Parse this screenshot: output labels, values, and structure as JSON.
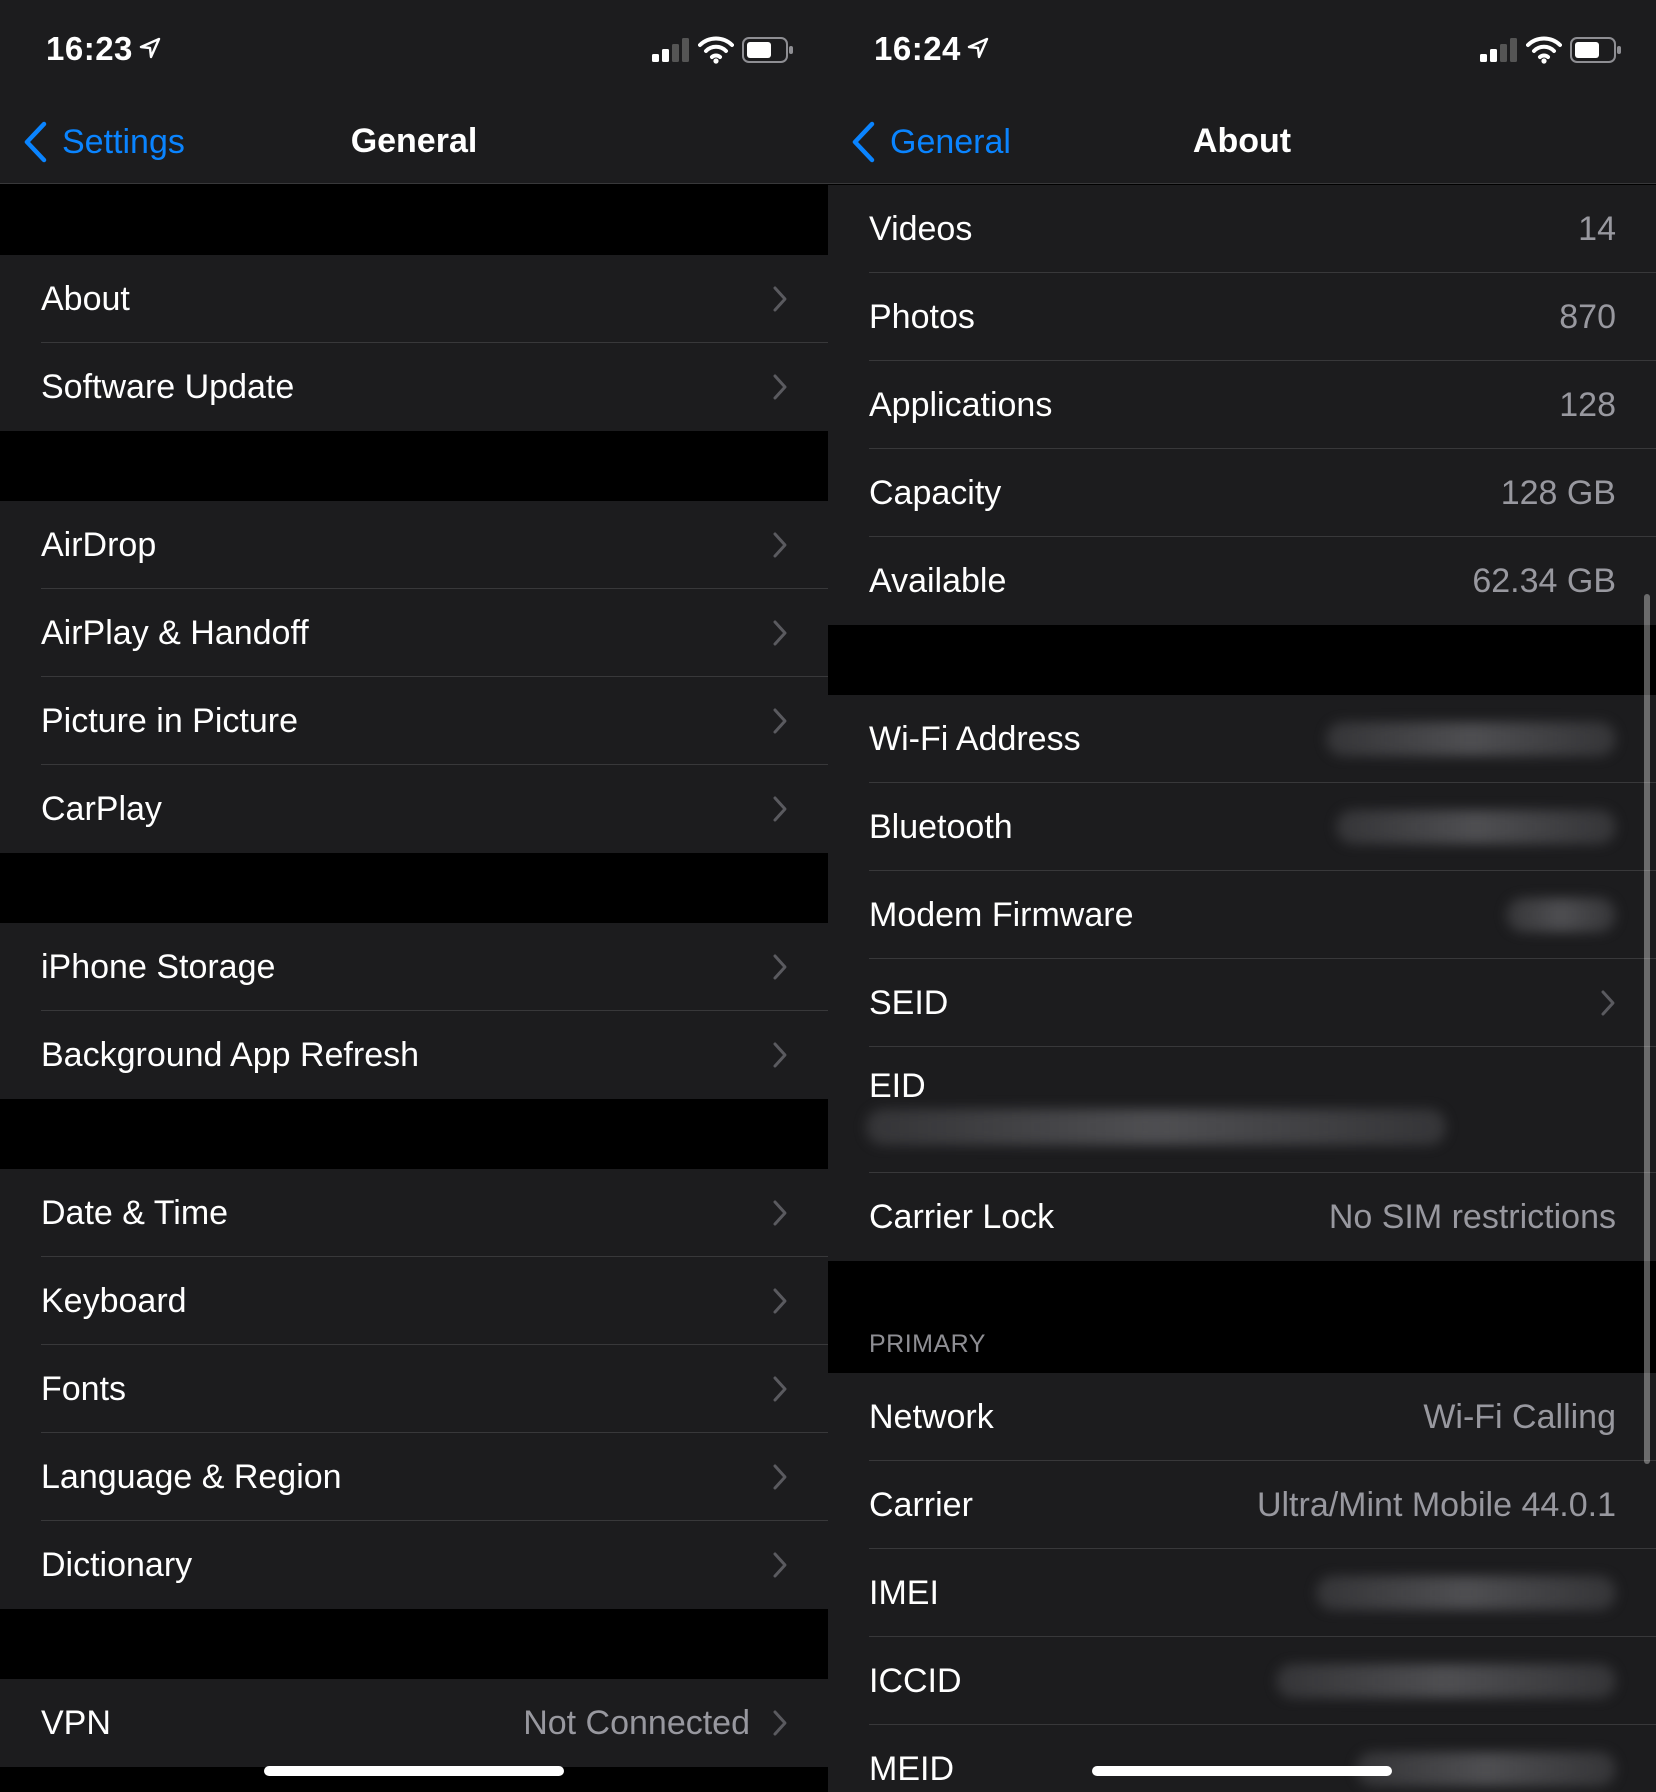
{
  "left": {
    "status": {
      "time": "16:23"
    },
    "nav": {
      "back_label": "Settings",
      "title": "General"
    },
    "groups": [
      [
        {
          "label": "About"
        },
        {
          "label": "Software Update"
        }
      ],
      [
        {
          "label": "AirDrop"
        },
        {
          "label": "AirPlay & Handoff"
        },
        {
          "label": "Picture in Picture"
        },
        {
          "label": "CarPlay"
        }
      ],
      [
        {
          "label": "iPhone Storage"
        },
        {
          "label": "Background App Refresh"
        }
      ],
      [
        {
          "label": "Date & Time"
        },
        {
          "label": "Keyboard"
        },
        {
          "label": "Fonts"
        },
        {
          "label": "Language & Region"
        },
        {
          "label": "Dictionary"
        }
      ],
      [
        {
          "label": "VPN",
          "value": "Not Connected"
        }
      ]
    ]
  },
  "right": {
    "status": {
      "time": "16:24"
    },
    "nav": {
      "back_label": "General",
      "title": "About"
    },
    "group1": [
      {
        "label": "Videos",
        "value": "14"
      },
      {
        "label": "Photos",
        "value": "870"
      },
      {
        "label": "Applications",
        "value": "128"
      },
      {
        "label": "Capacity",
        "value": "128 GB"
      },
      {
        "label": "Available",
        "value": "62.34 GB"
      }
    ],
    "group2": {
      "wifi": "Wi-Fi Address",
      "bluetooth": "Bluetooth",
      "modem": "Modem Firmware",
      "seid": "SEID",
      "eid": "EID",
      "carrier_lock": "Carrier Lock",
      "carrier_lock_value": "No SIM restrictions"
    },
    "section_header": "PRIMARY",
    "group3": {
      "network": "Network",
      "network_value": "Wi-Fi Calling",
      "carrier": "Carrier",
      "carrier_value": "Ultra/Mint Mobile 44.0.1",
      "imei": "IMEI",
      "iccid": "ICCID",
      "meid": "MEID"
    }
  },
  "colors": {
    "accent": "#0a84ff",
    "cell_bg": "#1c1c1e",
    "separator": "#38383a",
    "secondary_text": "#98989f"
  },
  "icons": [
    "location-arrow-icon",
    "cellular-signal-icon",
    "wifi-icon",
    "battery-icon",
    "chevron-left-icon",
    "chevron-right-icon"
  ]
}
